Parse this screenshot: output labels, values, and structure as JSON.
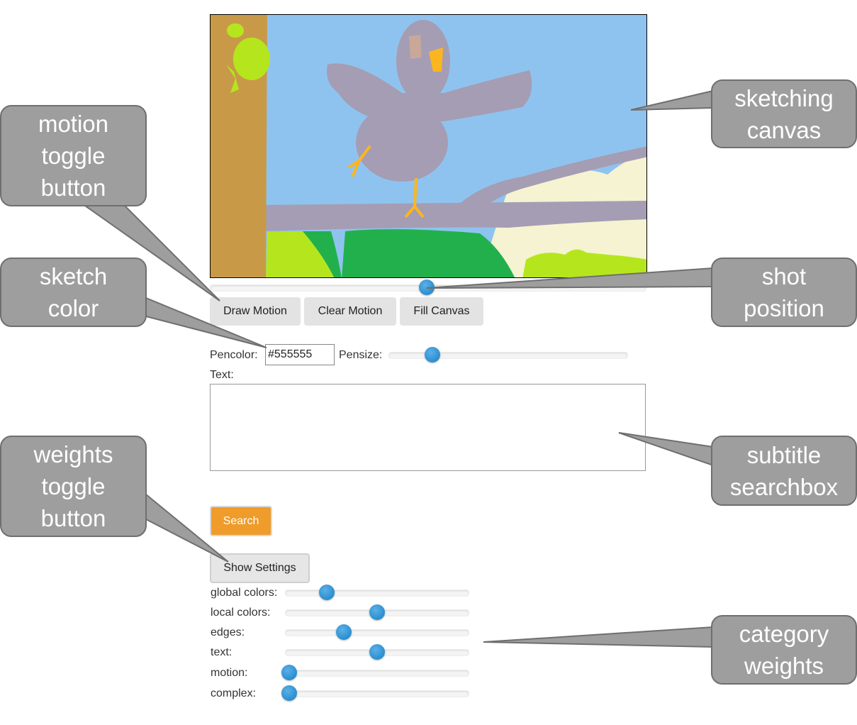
{
  "buttons": {
    "draw_motion": "Draw Motion",
    "clear_motion": "Clear Motion",
    "fill_canvas": "Fill Canvas",
    "search": "Search",
    "show_settings": "Show Settings"
  },
  "pen": {
    "pencolor_label": "Pencolor:",
    "pencolor_value": "#555555",
    "pensize_label": "Pensize:"
  },
  "text": {
    "label": "Text:",
    "value": ""
  },
  "weights": [
    {
      "label": "global colors:",
      "value": 0.2
    },
    {
      "label": "local colors:",
      "value": 0.5
    },
    {
      "label": "edges:",
      "value": 0.3
    },
    {
      "label": "text:",
      "value": 0.5
    },
    {
      "label": "motion:",
      "value": 0.0
    },
    {
      "label": "complex:",
      "value": 0.0
    }
  ],
  "callouts": {
    "sketching_canvas": [
      "sketching",
      "canvas"
    ],
    "motion_toggle": [
      "motion",
      "toggle",
      "button"
    ],
    "sketch_color": [
      "sketch",
      "color"
    ],
    "shot_position": [
      "shot",
      "position"
    ],
    "subtitle_searchbox": [
      "subtitle",
      "searchbox"
    ],
    "weights_toggle": [
      "weights",
      "toggle",
      "button"
    ],
    "category_weights": [
      "category",
      "weights"
    ]
  },
  "colors": {
    "sky": "#8fc3ef",
    "trunk": "#c89a47",
    "bird": "#a59db3",
    "grass": "#22b04c",
    "lime": "#b5e61d",
    "sand": "#f5f3d1",
    "beak": "#fbb61f",
    "search_button": "#ef9c2a",
    "slider_thumb": "#2b8ed0",
    "callout": "#9e9e9e"
  }
}
